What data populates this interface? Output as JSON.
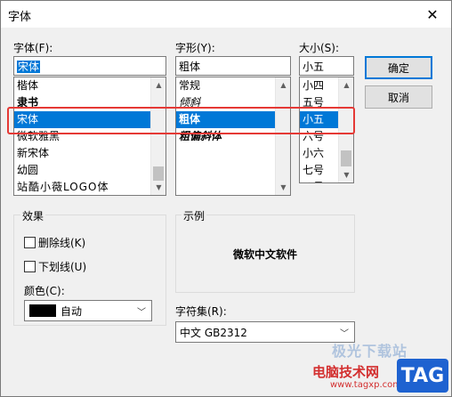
{
  "window": {
    "title": "字体"
  },
  "font": {
    "label": "字体(F):",
    "value": "宋体",
    "items": [
      "楷体",
      "隶书",
      "宋体",
      "微软雅黑",
      "新宋体",
      "幼圆",
      "站酷小薇LOGO体"
    ],
    "selected_index": 2
  },
  "style": {
    "label": "字形(Y):",
    "value": "粗体",
    "items": [
      "常规",
      "倾斜",
      "粗体",
      "粗偏斜体"
    ],
    "selected_index": 2
  },
  "size": {
    "label": "大小(S):",
    "value": "小五",
    "items": [
      "小四",
      "五号",
      "小五",
      "六号",
      "小六",
      "七号",
      "八号"
    ],
    "selected_index": 2
  },
  "buttons": {
    "ok": "确定",
    "cancel": "取消"
  },
  "effects": {
    "group_label": "效果",
    "strikeout": "删除线(K)",
    "underline": "下划线(U)",
    "color_label": "颜色(C):",
    "color_value": "自动",
    "color_hex": "#000000"
  },
  "sample": {
    "group_label": "示例",
    "text": "微软中文软件"
  },
  "charset": {
    "label": "字符集(R):",
    "value": "中文 GB2312"
  },
  "watermark": {
    "line1": "极光下载站",
    "line2": "电脑技术网",
    "line3": "www.tagxp.com",
    "badge": "TAG"
  },
  "colors": {
    "accent": "#0078d7",
    "highlight_border": "#e53935",
    "badge_blue": "#1e62d0"
  }
}
